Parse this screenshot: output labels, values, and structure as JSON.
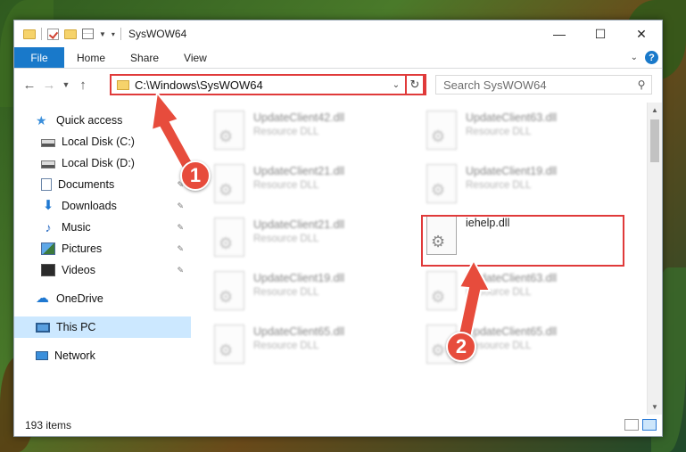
{
  "window": {
    "title": "SysWOW64",
    "controls": {
      "minimize": "—",
      "maximize": "☐",
      "close": "✕"
    }
  },
  "ribbon": {
    "tabs": [
      "File",
      "Home",
      "Share",
      "View"
    ],
    "help": "?"
  },
  "address": {
    "path": "C:\\Windows\\SysWOW64",
    "search_placeholder": "Search SysWOW64"
  },
  "nav": {
    "items": [
      {
        "label": "Quick access",
        "icon": "star-icon"
      },
      {
        "label": "Local Disk (C:)",
        "icon": "disk-icon"
      },
      {
        "label": "Local Disk (D:)",
        "icon": "disk-icon"
      },
      {
        "label": "Documents",
        "icon": "documents-icon"
      },
      {
        "label": "Downloads",
        "icon": "downloads-icon"
      },
      {
        "label": "Music",
        "icon": "music-icon"
      },
      {
        "label": "Pictures",
        "icon": "pictures-icon"
      },
      {
        "label": "Videos",
        "icon": "videos-icon"
      },
      {
        "label": "OneDrive",
        "icon": "cloud-icon"
      },
      {
        "label": "This PC",
        "icon": "computer-icon"
      },
      {
        "label": "Network",
        "icon": "network-icon"
      }
    ]
  },
  "files": {
    "items": [
      {
        "name": "UpdateClient42.dll",
        "type": "Resource DLL"
      },
      {
        "name": "UpdateClient63.dll",
        "type": "Resource DLL"
      },
      {
        "name": "UpdateClient21.dll",
        "type": "Resource DLL"
      },
      {
        "name": "UpdateClient19.dll",
        "type": "Resource DLL"
      },
      {
        "name": "UpdateClient21.dll",
        "type": "Resource DLL"
      },
      {
        "name": "iehelp.dll",
        "type": ""
      },
      {
        "name": "UpdateClient19.dll",
        "type": "Resource DLL"
      },
      {
        "name": "UpdateClient63.dll",
        "type": "Resource DLL"
      },
      {
        "name": "UpdateClient65.dll",
        "type": "Resource DLL"
      },
      {
        "name": "UpdateClient65.dll",
        "type": "Resource DLL"
      }
    ]
  },
  "status": {
    "count": "193 items"
  },
  "annotations": {
    "step1": "1",
    "step2": "2",
    "color": "#e74c3c"
  }
}
